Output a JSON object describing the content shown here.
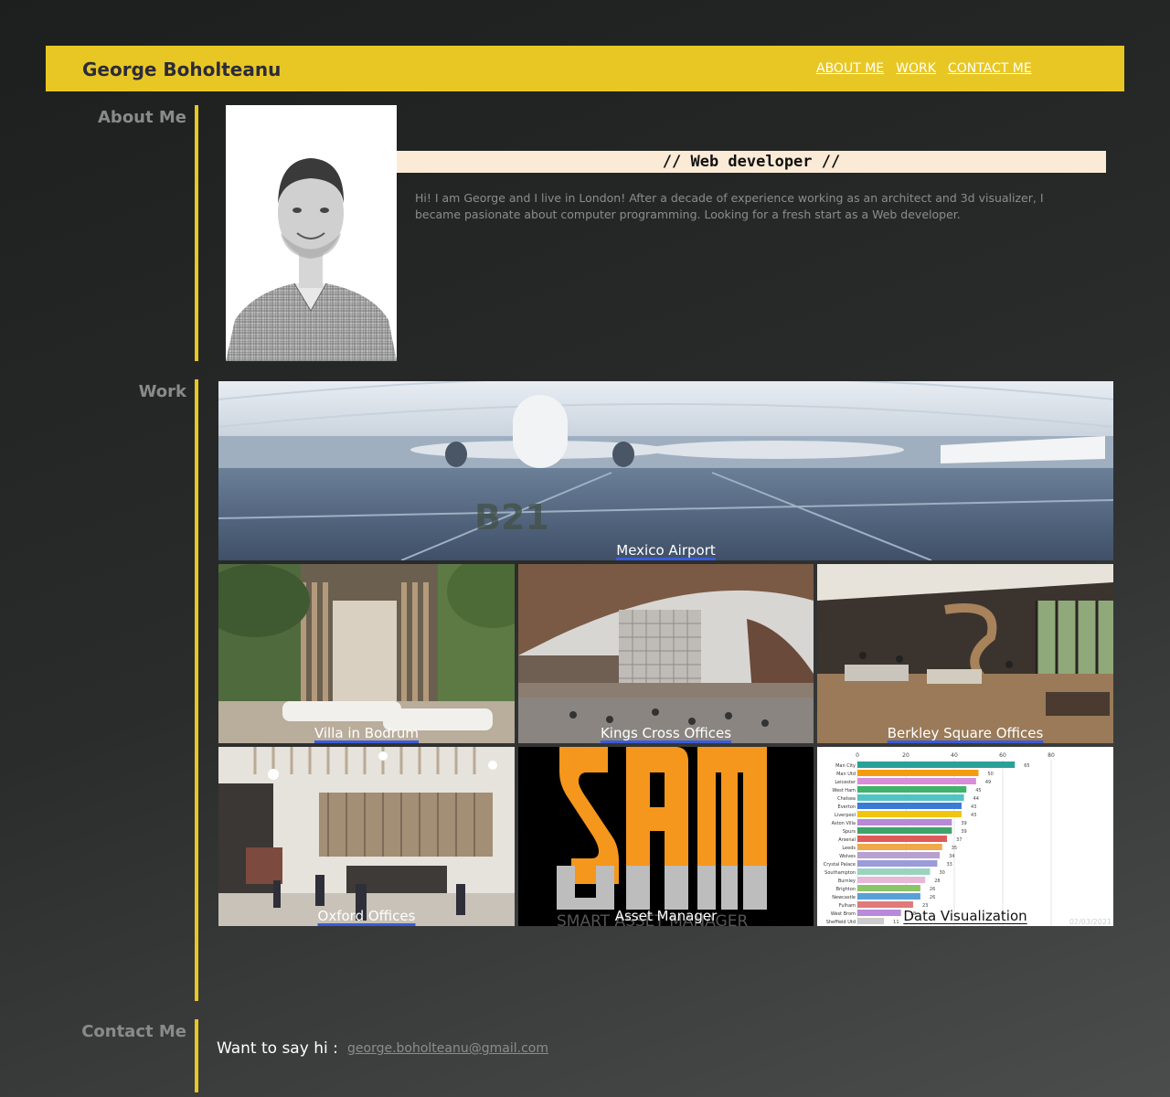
{
  "header": {
    "brand": "George Boholteanu",
    "nav": [
      "ABOUT ME",
      "WORK",
      "CONTACT ME"
    ]
  },
  "sections": {
    "about": "About Me",
    "work": "Work",
    "contact": "Contact Me"
  },
  "about": {
    "role": "// Web developer //",
    "bio": "Hi! I am George and I live in London! After a decade of experience working as an architect and 3d visualizer, I became pasionate about computer programming. Looking for a fresh start as a Web developer."
  },
  "work": {
    "items": [
      {
        "title": "Mexico Airport"
      },
      {
        "title": "Villa in Bodrum"
      },
      {
        "title": "Kings Cross Offices"
      },
      {
        "title": "Berkley Square Offices"
      },
      {
        "title": "Oxford Offices"
      },
      {
        "title": "Asset Manager"
      },
      {
        "title": "Data Visualization"
      }
    ],
    "sam_logo": {
      "letters": "SAM",
      "tagline": "SMART ASSET MANAGER"
    },
    "dataviz": {
      "axis_ticks": [
        "0",
        "20",
        "40",
        "60",
        "80"
      ],
      "date": "02/03/2021",
      "teams": [
        {
          "name": "Man City",
          "value": 65,
          "color": "#2aa198"
        },
        {
          "name": "Man Utd",
          "value": 50,
          "color": "#f39c12"
        },
        {
          "name": "Leicester",
          "value": 49,
          "color": "#d98cd9"
        },
        {
          "name": "West Ham",
          "value": 45,
          "color": "#3fb36b"
        },
        {
          "name": "Chelsea",
          "value": 44,
          "color": "#52c3c3"
        },
        {
          "name": "Everton",
          "value": 43,
          "color": "#3a7bd5"
        },
        {
          "name": "Liverpool",
          "value": 43,
          "color": "#f1c40f"
        },
        {
          "name": "Aston Villa",
          "value": 39,
          "color": "#b889d4"
        },
        {
          "name": "Spurs",
          "value": 39,
          "color": "#3fa36b"
        },
        {
          "name": "Arsenal",
          "value": 37,
          "color": "#e05a5a"
        },
        {
          "name": "Leeds",
          "value": 35,
          "color": "#f0a94a"
        },
        {
          "name": "Wolves",
          "value": 34,
          "color": "#b8a0d0"
        },
        {
          "name": "Crystal Palace",
          "value": 33,
          "color": "#9b9bd9"
        },
        {
          "name": "Southampton",
          "value": 30,
          "color": "#9ad4c0"
        },
        {
          "name": "Burnley",
          "value": 28,
          "color": "#e8b8d8"
        },
        {
          "name": "Brighton",
          "value": 26,
          "color": "#8cc46a"
        },
        {
          "name": "Newcastle",
          "value": 26,
          "color": "#5aa0d8"
        },
        {
          "name": "Fulham",
          "value": 23,
          "color": "#e07a7a"
        },
        {
          "name": "West Brom",
          "value": 18,
          "color": "#b88ad9"
        },
        {
          "name": "Sheffield Utd",
          "value": 11,
          "color": "#cccccc"
        }
      ]
    }
  },
  "contact": {
    "prompt": "Want to say hi :",
    "email": "george.boholteanu@gmail.com"
  }
}
